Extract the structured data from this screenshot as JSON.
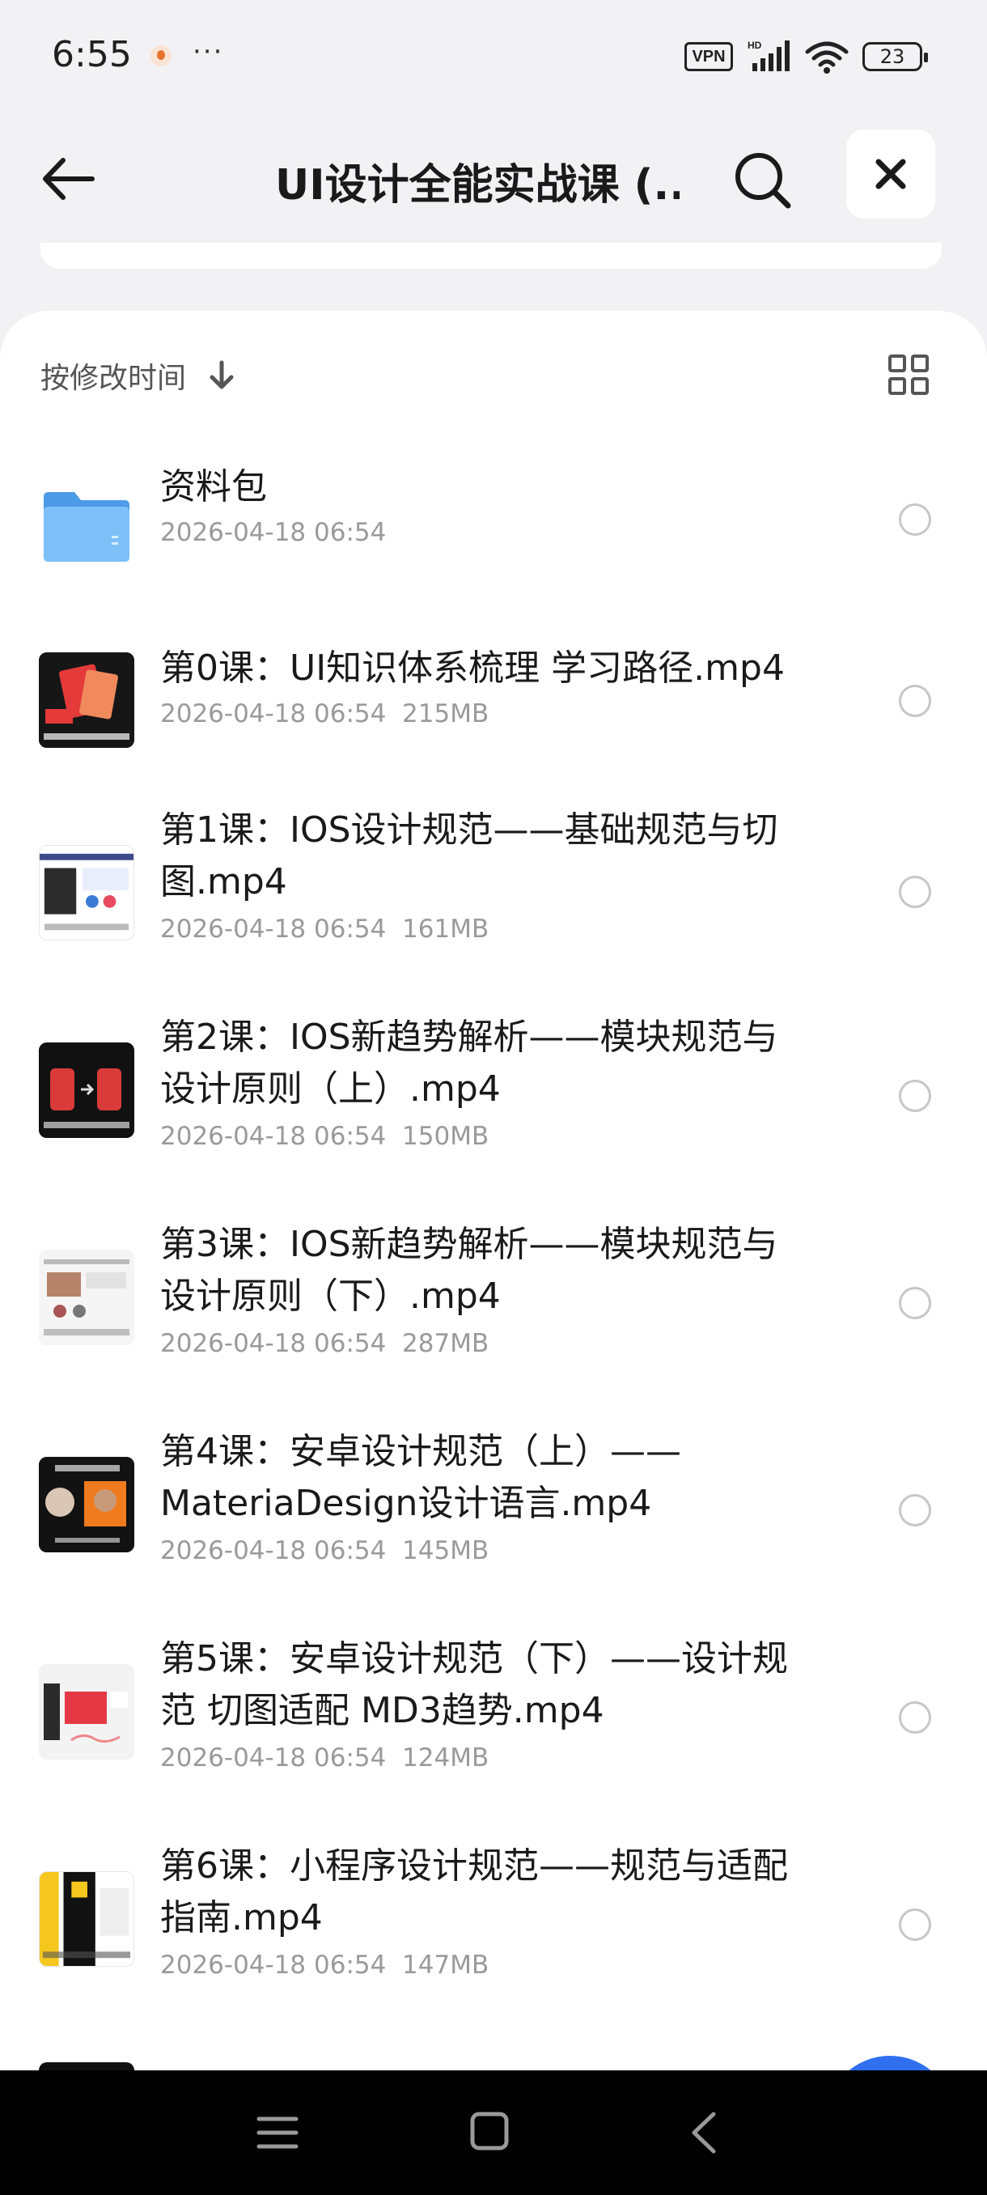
{
  "status_bar": {
    "time": "6:55",
    "more": "···",
    "vpn": "VPN",
    "network": "HD",
    "battery": "23"
  },
  "header": {
    "title": "UI设计全能实战课 (..."
  },
  "sort": {
    "label": "按修改时间"
  },
  "files": [
    {
      "name": "资料包",
      "meta": "2026-04-18 06:54",
      "type": "folder"
    },
    {
      "name": "第0课：UI知识体系梳理 学习路径.mp4",
      "meta": "2026-04-18 06:54  215MB",
      "type": "video"
    },
    {
      "name": "第1课：IOS设计规范——基础规范与切图.mp4",
      "meta": "2026-04-18 06:54  161MB",
      "type": "video"
    },
    {
      "name": "第2课：IOS新趋势解析——模块规范与设计原则（上）.mp4",
      "meta": "2026-04-18 06:54  150MB",
      "type": "video"
    },
    {
      "name": "第3课：IOS新趋势解析——模块规范与设计原则（下）.mp4",
      "meta": "2026-04-18 06:54  287MB",
      "type": "video"
    },
    {
      "name": "第4课：安卓设计规范（上）——MateriaDesign设计语言.mp4",
      "meta": "2026-04-18 06:54  145MB",
      "type": "video"
    },
    {
      "name": "第5课：安卓设计规范（下）——设计规范 切图适配 MD3趋势.mp4",
      "meta": "2026-04-18 06:54  124MB",
      "type": "video"
    },
    {
      "name": "第6课：小程序设计规范——规范与适配指南.mp4",
      "meta": "2026-04-18 06:54  147MB",
      "type": "video"
    }
  ],
  "icons": {
    "back": "back-arrow-icon",
    "search": "search-icon",
    "close": "close-icon",
    "sort": "arrow-down-icon",
    "grid": "grid-view-icon",
    "folder": "folder-icon"
  },
  "colors": {
    "background": "#f2f2f4",
    "folder": "#5aa9f0",
    "fab": "#2f6ff0",
    "meta_text": "#9a9a9a"
  }
}
